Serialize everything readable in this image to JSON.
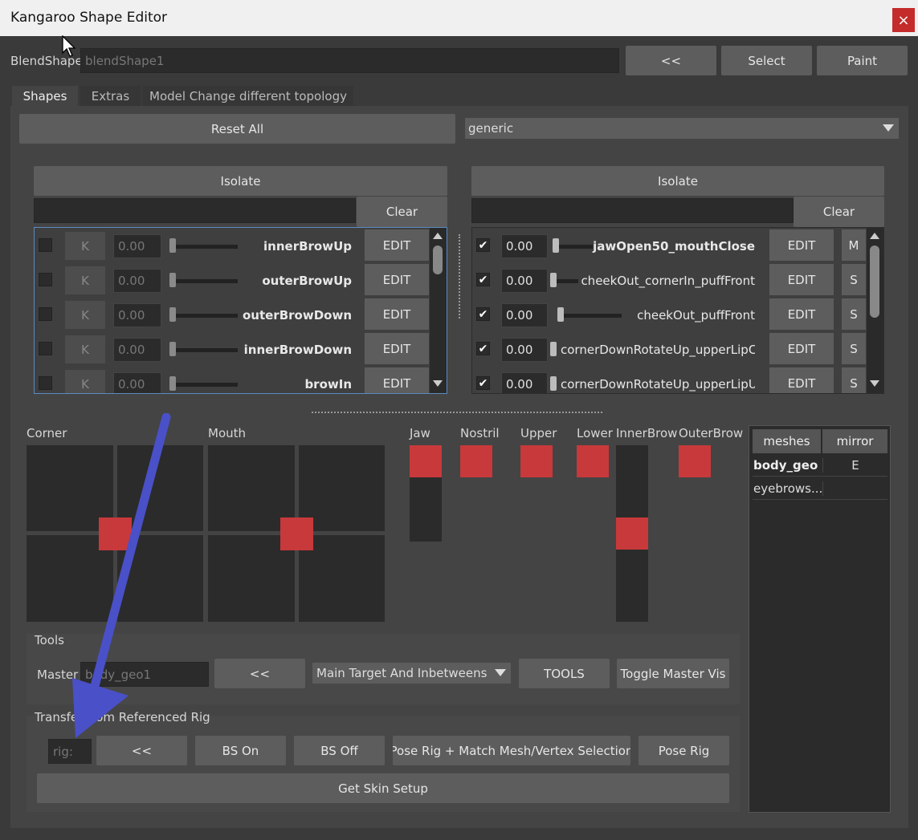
{
  "window": {
    "title": "Kangaroo Shape Editor",
    "close_glyph": "×"
  },
  "blendshape": {
    "label": "BlendShape",
    "value": "blendShape1",
    "back_label": "<<",
    "select_label": "Select",
    "paint_label": "Paint"
  },
  "tabs": [
    {
      "label": "Shapes",
      "active": true
    },
    {
      "label": "Extras"
    },
    {
      "label": "Model Change different topology"
    }
  ],
  "shapes_tab": {
    "reset_all_label": "Reset All",
    "dropdown_value": "generic",
    "left_panel": {
      "isolate_label": "Isolate",
      "clear_label": "Clear",
      "filter_value": "",
      "rows": [
        {
          "k": "K",
          "value": "0.00",
          "name": "innerBrowUp",
          "edit": "EDIT"
        },
        {
          "k": "K",
          "value": "0.00",
          "name": "outerBrowUp",
          "edit": "EDIT"
        },
        {
          "k": "K",
          "value": "0.00",
          "name": "outerBrowDown",
          "edit": "EDIT"
        },
        {
          "k": "K",
          "value": "0.00",
          "name": "innerBrowDown",
          "edit": "EDIT"
        },
        {
          "k": "K",
          "value": "0.00",
          "name": "browIn",
          "edit": "EDIT"
        }
      ]
    },
    "right_panel": {
      "isolate_label": "Isolate",
      "clear_label": "Clear",
      "filter_value": "",
      "rows": [
        {
          "checked": true,
          "value": "0.00",
          "name": "jawOpen50_mouthClose",
          "edit": "EDIT",
          "flag": "M",
          "bold": true
        },
        {
          "checked": true,
          "value": "0.00",
          "name": "cheekOut_cornerIn_puffFront",
          "edit": "EDIT",
          "flag": "S"
        },
        {
          "checked": true,
          "value": "0.00",
          "name": "cheekOut_puffFront",
          "edit": "EDIT",
          "flag": "S"
        },
        {
          "checked": true,
          "value": "0.00",
          "name": "cornerDownRotateUp_upperLipC",
          "edit": "EDIT",
          "flag": "S"
        },
        {
          "checked": true,
          "value": "0.00",
          "name": "cornerDownRotateUp_upperLipU",
          "edit": "EDIT",
          "flag": "S"
        }
      ]
    },
    "pad_labels": {
      "corner": "Corner",
      "mouth": "Mouth",
      "jaw": "Jaw",
      "nostril": "Nostril",
      "upper": "Upper",
      "lower": "Lower",
      "inner_brow": "InnerBrow",
      "outer_brow": "OuterBrow"
    },
    "meshes_table": {
      "headers": [
        "meshes",
        "mirror"
      ],
      "rows": [
        {
          "mesh": "body_geo",
          "mirror": "E",
          "bold": true
        },
        {
          "mesh": "eyebrows...",
          "mirror": ""
        }
      ]
    },
    "tools": {
      "title": "Tools",
      "master_label": "Master",
      "master_value": "body_geo1",
      "back_label": "<<",
      "mode_value": "Main Target And Inbetweens",
      "tools_label": "TOOLS",
      "toggle_label": "Toggle Master Vis"
    },
    "transfer": {
      "title": "Transfer from Referenced Rig",
      "rig_placeholder": "rig:",
      "back_label": "<<",
      "bs_on_label": "BS On",
      "bs_off_label": "BS Off",
      "pose_match_label": "Pose Rig + Match Mesh/Vertex Selection",
      "pose_rig_label": "Pose Rig",
      "skin_label": "Get Skin Setup"
    }
  },
  "colors": {
    "accent_knob": "#c8393b",
    "annotation_arrow": "#4a50c8"
  }
}
